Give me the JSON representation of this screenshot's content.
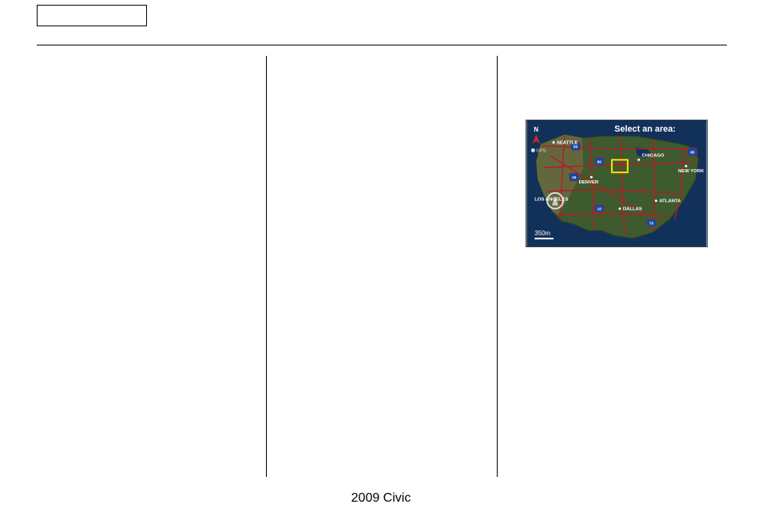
{
  "footer": {
    "text": "2009  Civic"
  },
  "map": {
    "title": "Select an area:",
    "scale_label": "350m",
    "gps_label": "GPS",
    "north_label": "N",
    "cities": [
      {
        "name": "SEATTLE"
      },
      {
        "name": "DENVER"
      },
      {
        "name": "LOS ANGELES"
      },
      {
        "name": "CHICAGO"
      },
      {
        "name": "DALLAS"
      },
      {
        "name": "ATLANTA"
      },
      {
        "name": "NEW YORK"
      }
    ],
    "interstates": [
      "90",
      "80",
      "15",
      "10",
      "75",
      "95"
    ]
  }
}
